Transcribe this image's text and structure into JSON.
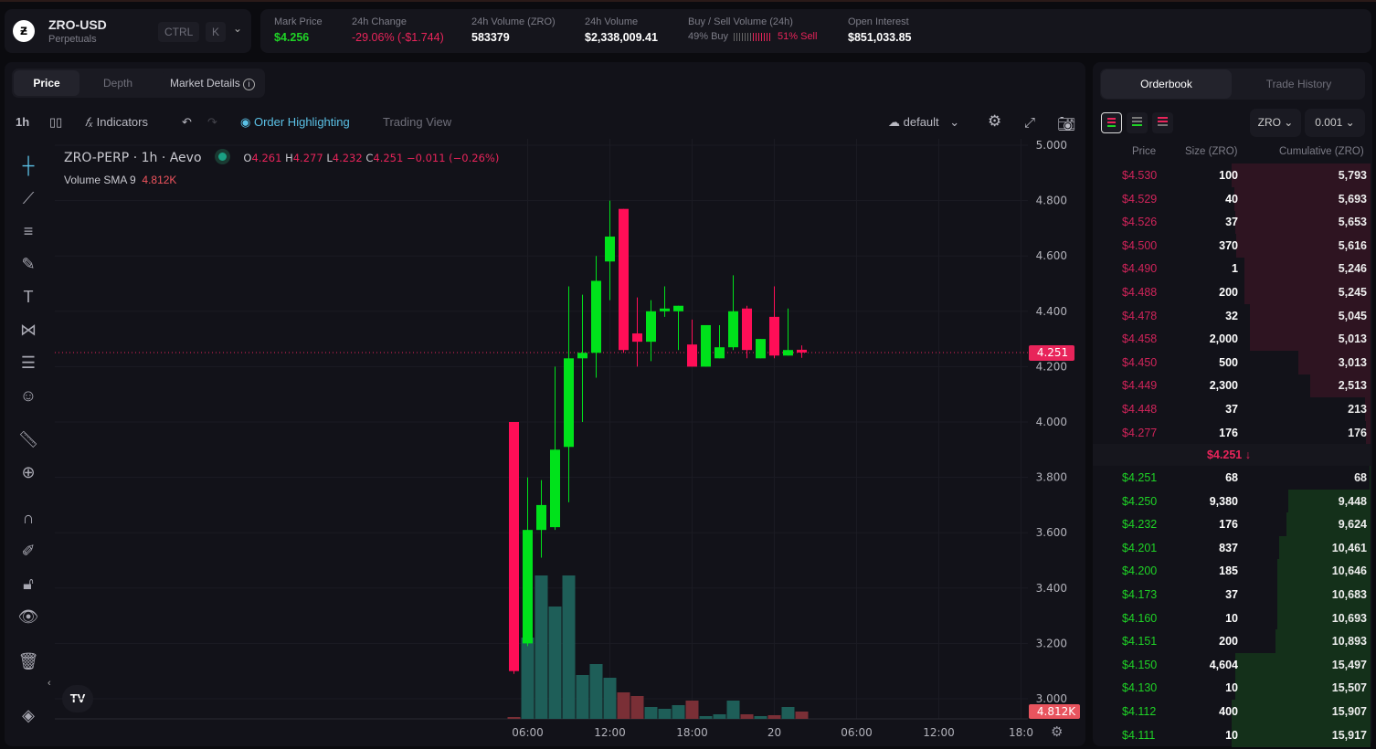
{
  "header": {
    "symbol": "ZRO-USD",
    "subtitle": "Perpetuals",
    "shortcut_ctrl": "CTRL",
    "shortcut_k": "K",
    "stats": [
      {
        "label": "Mark Price",
        "value": "$4.256",
        "color": "#1fd326"
      },
      {
        "label": "24h Change",
        "value": "-29.06% (-$1.744)",
        "color": "#e8245a"
      },
      {
        "label": "24h Volume (ZRO)",
        "value": "583379",
        "color": "#ffffff"
      },
      {
        "label": "24h Volume",
        "value": "$2,338,009.41",
        "color": "#ffffff"
      }
    ],
    "buysell": {
      "label": "Buy / Sell Volume (24h)",
      "buy": "49% Buy",
      "sell": "51% Sell",
      "buy_fraction": 0.49
    },
    "open_interest": {
      "label": "Open Interest",
      "value": "$851,033.85"
    }
  },
  "chart_tabs": {
    "price": "Price",
    "depth": "Depth",
    "market_details": "Market Details"
  },
  "toolbar": {
    "interval": "1h",
    "indicators": "Indicators",
    "order_highlighting": "Order Highlighting",
    "trading_view": "Trading View",
    "layout": "default"
  },
  "legend": {
    "title": "ZRO-PERP · 1h · Aevo",
    "o_label": "O",
    "o": "4.261",
    "h_label": "H",
    "h": "4.277",
    "l_label": "L",
    "l": "4.232",
    "c_label": "C",
    "c": "4.251",
    "change": "−0.011 (−0.26%)",
    "volume_label": "Volume SMA 9",
    "volume_value": "4.812K"
  },
  "chart_data": {
    "type": "candlestick",
    "interval": "1h",
    "ylim": [
      3.0,
      5.0
    ],
    "y_ticks": [
      "5.000",
      "4.800",
      "4.600",
      "4.400",
      "4.200",
      "4.000",
      "3.800",
      "3.600",
      "3.400",
      "3.200",
      "3.000"
    ],
    "x_ticks": [
      {
        "label": "06:00",
        "index": 1
      },
      {
        "label": "12:00",
        "index": 7
      },
      {
        "label": "18:00",
        "index": 13
      },
      {
        "label": "20",
        "index": 19
      },
      {
        "label": "06:00",
        "index": 25
      },
      {
        "label": "12:00",
        "index": 31
      },
      {
        "label": "18:0",
        "index": 37
      }
    ],
    "last_price_label": "4.251",
    "volume_sma_label": "4.812K",
    "up_color": "#00e21b",
    "down_color": "#ff0e57",
    "vol_up_color": "#1e5e58",
    "vol_down_color": "#7a2f36",
    "candles": [
      {
        "o": 4.0,
        "h": 4.0,
        "l": 3.09,
        "c": 3.1,
        "v": 1200
      },
      {
        "o": 3.2,
        "h": 3.8,
        "l": 3.19,
        "c": 3.61,
        "v": 53400
      },
      {
        "o": 3.61,
        "h": 3.79,
        "l": 3.51,
        "c": 3.7,
        "v": 94200
      },
      {
        "o": 3.62,
        "h": 4.2,
        "l": 3.61,
        "c": 3.9,
        "v": 73800
      },
      {
        "o": 3.91,
        "h": 4.49,
        "l": 3.71,
        "c": 4.23,
        "v": 94200
      },
      {
        "o": 4.23,
        "h": 4.46,
        "l": 4.0,
        "c": 4.25,
        "v": 28800
      },
      {
        "o": 4.25,
        "h": 4.6,
        "l": 4.16,
        "c": 4.51,
        "v": 36000
      },
      {
        "o": 4.58,
        "h": 4.8,
        "l": 4.44,
        "c": 4.67,
        "v": 27000
      },
      {
        "o": 4.77,
        "h": 4.77,
        "l": 4.25,
        "c": 4.26,
        "v": 17400
      },
      {
        "o": 4.32,
        "h": 4.45,
        "l": 4.2,
        "c": 4.29,
        "v": 15000
      },
      {
        "o": 4.29,
        "h": 4.44,
        "l": 4.22,
        "c": 4.4,
        "v": 7800
      },
      {
        "o": 4.4,
        "h": 4.49,
        "l": 4.38,
        "c": 4.41,
        "v": 6600
      },
      {
        "o": 4.4,
        "h": 4.42,
        "l": 4.26,
        "c": 4.42,
        "v": 9000
      },
      {
        "o": 4.28,
        "h": 4.37,
        "l": 4.2,
        "c": 4.2,
        "v": 12000
      },
      {
        "o": 4.2,
        "h": 4.35,
        "l": 4.2,
        "c": 4.35,
        "v": 1800
      },
      {
        "o": 4.23,
        "h": 4.35,
        "l": 4.23,
        "c": 4.27,
        "v": 3000
      },
      {
        "o": 4.27,
        "h": 4.53,
        "l": 4.26,
        "c": 4.4,
        "v": 12000
      },
      {
        "o": 4.41,
        "h": 4.42,
        "l": 4.23,
        "c": 4.26,
        "v": 3000
      },
      {
        "o": 4.23,
        "h": 4.3,
        "l": 4.23,
        "c": 4.3,
        "v": 1800
      },
      {
        "o": 4.38,
        "h": 4.49,
        "l": 4.23,
        "c": 4.24,
        "v": 2400
      },
      {
        "o": 4.24,
        "h": 4.41,
        "l": 4.24,
        "c": 4.26,
        "v": 7800
      },
      {
        "o": 4.261,
        "h": 4.277,
        "l": 4.232,
        "c": 4.251,
        "v": 4800
      }
    ]
  },
  "orderbook": {
    "tabs": [
      "Orderbook",
      "Trade History"
    ],
    "unit": "ZRO",
    "tick": "0.001",
    "headers": [
      "Price",
      "Size (ZRO)",
      "Cumulative (ZRO)"
    ],
    "asks": [
      [
        "$4.530",
        "100",
        "5,793"
      ],
      [
        "$4.529",
        "40",
        "5,693"
      ],
      [
        "$4.526",
        "37",
        "5,653"
      ],
      [
        "$4.500",
        "370",
        "5,616"
      ],
      [
        "$4.490",
        "1",
        "5,246"
      ],
      [
        "$4.488",
        "200",
        "5,245"
      ],
      [
        "$4.478",
        "32",
        "5,045"
      ],
      [
        "$4.458",
        "2,000",
        "5,013"
      ],
      [
        "$4.450",
        "500",
        "3,013"
      ],
      [
        "$4.449",
        "2,300",
        "2,513"
      ],
      [
        "$4.448",
        "37",
        "213"
      ],
      [
        "$4.277",
        "176",
        "176"
      ]
    ],
    "last_price": "$4.251",
    "bids": [
      [
        "$4.251",
        "68",
        "68"
      ],
      [
        "$4.250",
        "9,380",
        "9,448"
      ],
      [
        "$4.232",
        "176",
        "9,624"
      ],
      [
        "$4.201",
        "837",
        "10,461"
      ],
      [
        "$4.200",
        "185",
        "10,646"
      ],
      [
        "$4.173",
        "37",
        "10,683"
      ],
      [
        "$4.160",
        "10",
        "10,693"
      ],
      [
        "$4.151",
        "200",
        "10,893"
      ],
      [
        "$4.150",
        "4,604",
        "15,497"
      ],
      [
        "$4.130",
        "10",
        "15,507"
      ],
      [
        "$4.112",
        "400",
        "15,907"
      ],
      [
        "$4.111",
        "10",
        "15,917"
      ]
    ]
  }
}
